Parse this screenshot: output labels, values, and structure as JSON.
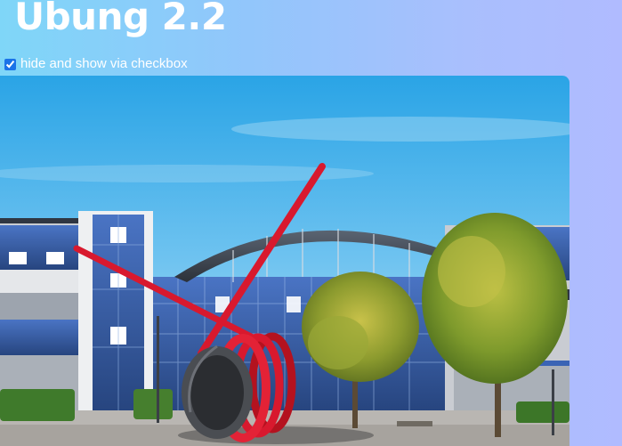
{
  "page": {
    "title": "Übung 2.2"
  },
  "toggle": {
    "label": "hide and show via checkbox",
    "checked": true
  },
  "image": {
    "alt": "Campus building with red sculpture"
  },
  "colors": {
    "title_text": "#ffffff",
    "sculpture_red": "#d8192e",
    "sky": "#4fb6ec",
    "glass": "#3a64b5"
  }
}
